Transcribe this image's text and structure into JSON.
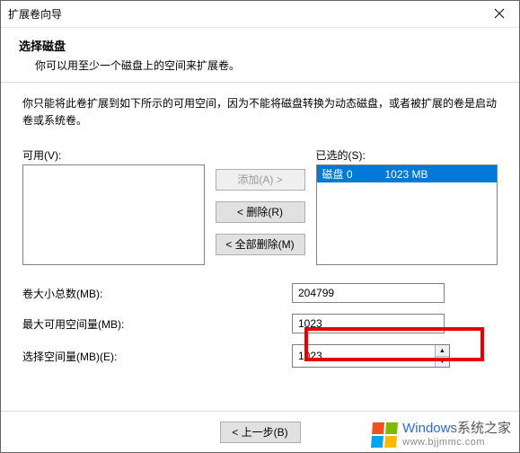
{
  "titlebar": {
    "title": "扩展卷向导"
  },
  "header": {
    "heading": "选择磁盘",
    "subtext": "你可以用至少一个磁盘上的空间来扩展卷。"
  },
  "instruction": "你只能将此卷扩展到如下所示的可用空间，因为不能将磁盘转换为动态磁盘，或者被扩展的卷是启动卷或系统卷。",
  "labels": {
    "available": "可用(V):",
    "selected": "已选的(S):"
  },
  "buttons": {
    "add": "添加(A) >",
    "remove": "< 删除(R)",
    "remove_all": "< 全部删除(M)",
    "back": "< 上一步(B)"
  },
  "selected_list": [
    {
      "disk": "磁盘 0",
      "size": "1023 MB"
    }
  ],
  "fields": {
    "total_label": "卷大小总数(MB):",
    "total_value": "204799",
    "max_label": "最大可用空间量(MB):",
    "max_value": "1023",
    "select_label": "选择空间量(MB)(E):",
    "select_value": "1023"
  },
  "watermark": {
    "brand": "Windows",
    "brand_zh": "系统之家",
    "url": "www.bjjmmc.com",
    "colors": [
      "#f25022",
      "#7fba00",
      "#00a4ef",
      "#ffb900"
    ]
  }
}
